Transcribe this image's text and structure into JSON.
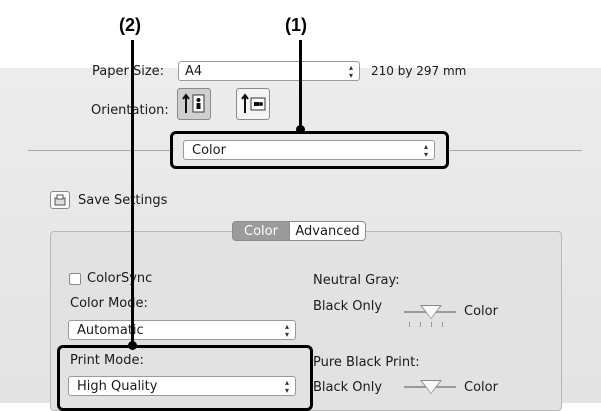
{
  "callouts": {
    "label1": "(1)",
    "label2": "(2)"
  },
  "dialog": {
    "paper_size_label": "Paper Size:",
    "paper_size_value": "A4",
    "paper_size_dims": "210 by 297 mm",
    "orientation_label": "Orientation:",
    "pane_menu_value": "Color",
    "save_settings_label": "Save Settings"
  },
  "tabs": {
    "color": "Color",
    "advanced": "Advanced"
  },
  "color_pane": {
    "colorsync_label": "ColorSync",
    "color_mode_label": "Color Mode:",
    "color_mode_value": "Automatic",
    "print_mode_label": "Print Mode:",
    "print_mode_value": "High Quality",
    "neutral_gray_label": "Neutral Gray:",
    "neutral_gray_left": "Black Only",
    "neutral_gray_right": "Color",
    "pure_black_label": "Pure Black Print:",
    "pure_black_left": "Black Only",
    "pure_black_right": "Color"
  },
  "colors": {
    "panel": "#e8e8e8",
    "selected_tab": "#9b9b9b",
    "callout": "#000000"
  }
}
